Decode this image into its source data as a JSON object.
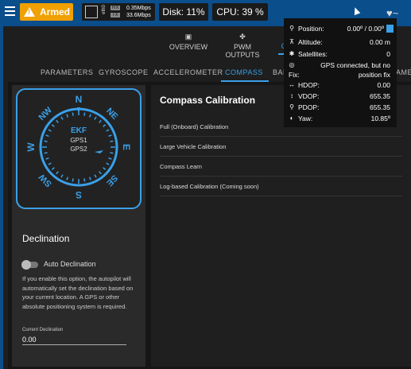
{
  "status": {
    "armed_label": "Armed",
    "net": {
      "eth_label": "eth0",
      "rx_label": "RX",
      "tx_label": "TX",
      "rx_rate": "0.35Mbps",
      "tx_rate": "33.6Mbps"
    },
    "disk_label": "Disk: 11%",
    "cpu_label": "CPU: 39 %"
  },
  "top_tabs": [
    {
      "label": "OVERVIEW",
      "icon": "chip-icon"
    },
    {
      "label": "PWM OUTPUTS",
      "icon": "fan-icon"
    },
    {
      "label": "C",
      "icon": "compass-icon"
    }
  ],
  "sub_tabs": [
    {
      "label": "PARAMETERS"
    },
    {
      "label": "GYROSCOPE"
    },
    {
      "label": "ACCELEROMETER"
    },
    {
      "label": "COMPASS"
    },
    {
      "label": "BAR"
    },
    {
      "label": "AME"
    }
  ],
  "compass": {
    "directions": [
      "N",
      "NE",
      "E",
      "SE",
      "S",
      "SW",
      "W",
      "NW"
    ],
    "labels": [
      "EKF",
      "GPS1",
      "GPS2"
    ]
  },
  "declination": {
    "title": "Declination",
    "toggle_label": "Auto Declination",
    "auto_enabled": false,
    "help_text": "If you enable this option, the autopilot will automatically set the declination based on your current location. A GPS or other absolute positioning system is required.",
    "field_label": "Current Declination",
    "field_value": "0.00"
  },
  "calibration": {
    "title": "Compass Calibration",
    "items": [
      "Full (Onboard) Calibration",
      "Large Vehicle Calibration",
      "Compass Learn",
      "Log-based Calibration (Coming soon)"
    ]
  },
  "gps_tooltip": {
    "position_label": "Position:",
    "position_value": "0.00º / 0.00º",
    "altitude_label": "Altitude:",
    "altitude_value": "0.00 m",
    "satellites_label": "Satellites:",
    "satellites_value": "0",
    "fix_status_value": "GPS connected, but no",
    "fix_label": "Fix:",
    "fix_value": "position fix",
    "hdop_label": "HDOP:",
    "hdop_value": "0.00",
    "vdop_label": "VDOP:",
    "vdop_value": "655.35",
    "pdop_label": "PDOP:",
    "pdop_value": "655.35",
    "yaw_label": "Yaw:",
    "yaw_value": "10.85º"
  },
  "colors": {
    "accent": "#3aa0e8",
    "top_bar": "#0b4e8c",
    "armed": "#f0a000",
    "panel": "#1e1e1e"
  }
}
